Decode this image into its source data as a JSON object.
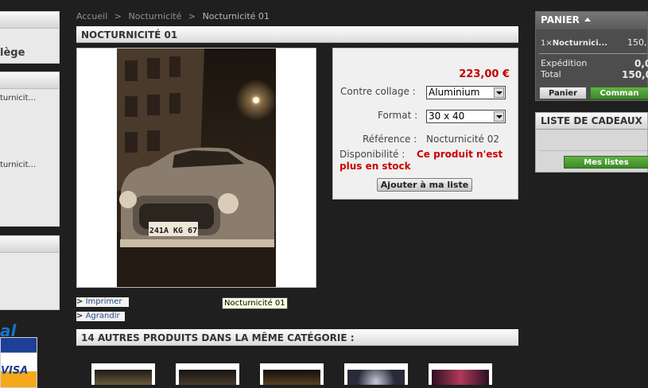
{
  "breadcrumb": {
    "home": "Accueil",
    "sep1": ">",
    "category": "Nocturnicité",
    "sep2": ">",
    "current": "Nocturnicité 01"
  },
  "product": {
    "title": "NOCTURNICITÉ 01",
    "photo_plate": "241A KG 67",
    "price": "223,00 €",
    "option1_label": "Contre collage :",
    "option1_value": "Aluminium",
    "option2_label": "Format :",
    "option2_value": "30 x 40",
    "reference_label": "Référence :",
    "reference_value": "Nocturnicité 02",
    "availability_label": "Disponibilité :",
    "availability_value": "Ce produit n'est plus en stock",
    "wishlist_button": "Ajouter à ma liste",
    "print_link": "Imprimer",
    "enlarge_link": "Agrandir",
    "link_marker": ">",
    "tooltip": "Nocturnicité 01"
  },
  "same_category": {
    "title": "14 AUTRES PRODUITS DANS LA MÊME CATÉGORIE :"
  },
  "left_column": {
    "box1_text": "lège",
    "box2_items": [
      "turnicit...",
      "turnicit..."
    ],
    "payment_text": "al",
    "visa": "VISA"
  },
  "cart": {
    "title": "PANIER",
    "item_qty": "1×",
    "item_name": "Nocturnici...",
    "item_price": "150,",
    "shipping_label": "Expédition",
    "shipping_value": "0,0",
    "total_label": "Total",
    "total_value": "150,0",
    "cart_button": "Panier",
    "order_button": "Comman"
  },
  "gift_list": {
    "title": "LISTE DE CADEAUX",
    "button": "Mes listes"
  },
  "colors": {
    "price": "#c40000",
    "availability": "#cc0000",
    "green": "#4a9a32",
    "link": "#2a4a8a"
  }
}
